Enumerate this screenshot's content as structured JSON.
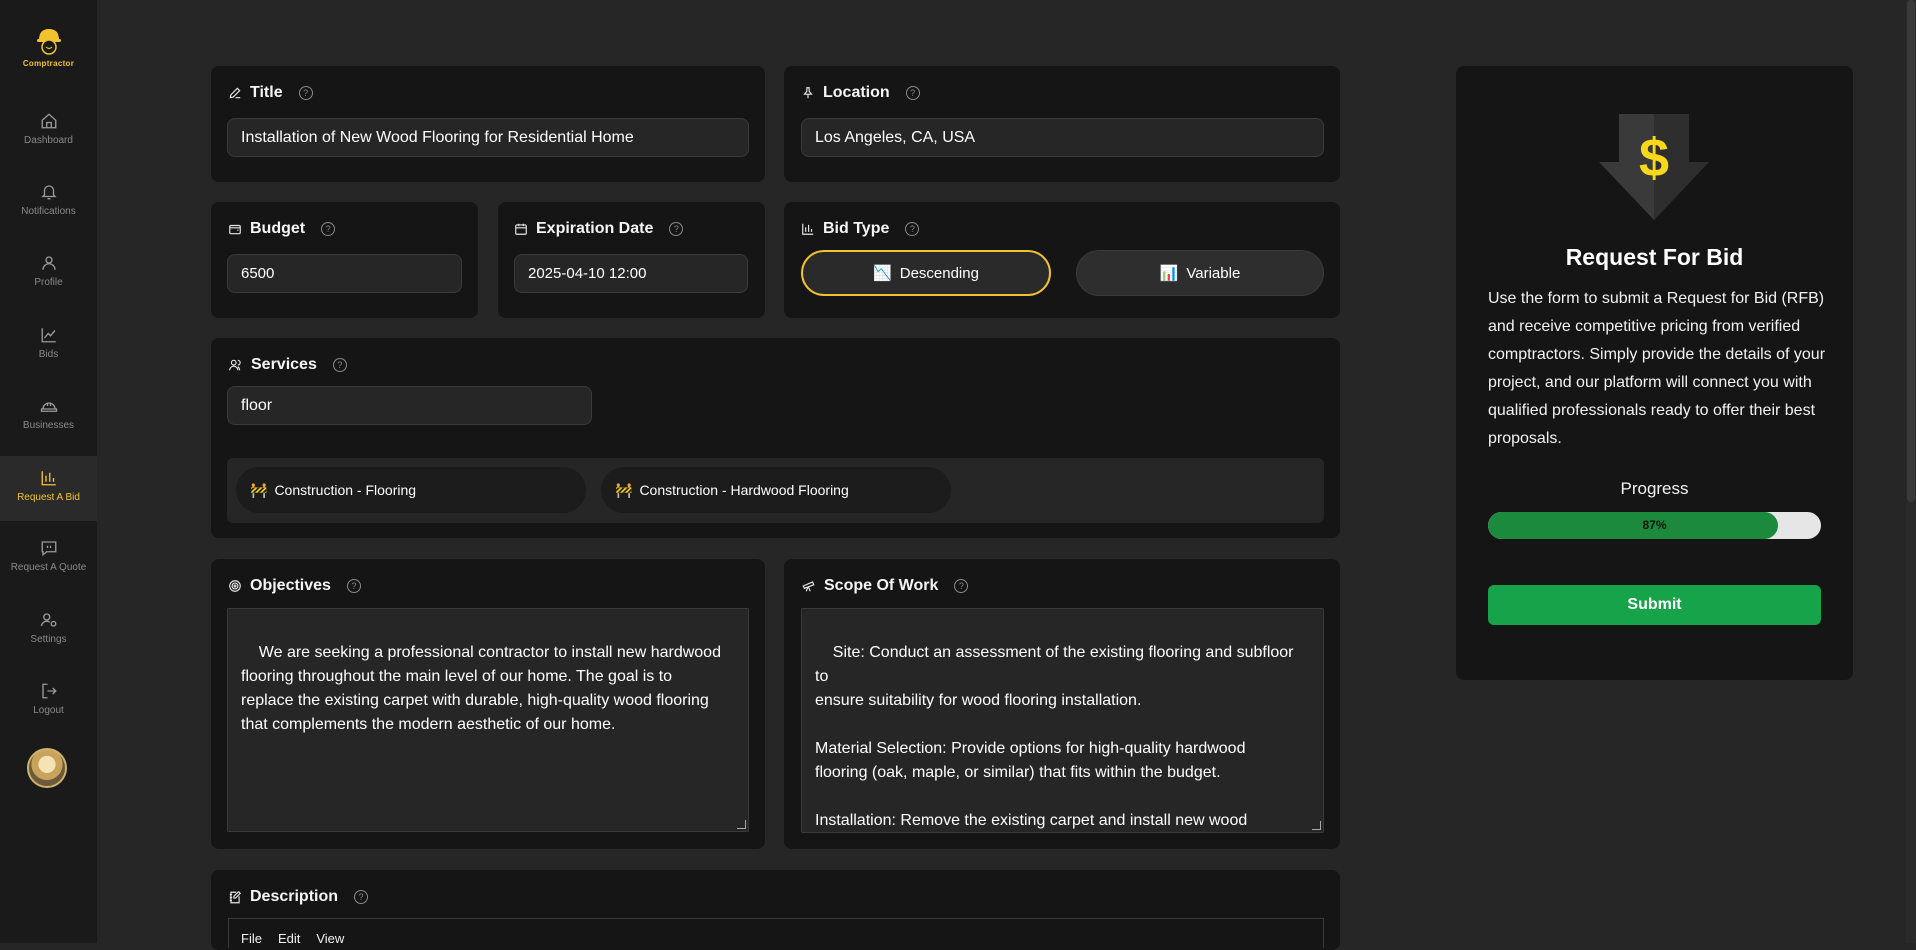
{
  "brand": {
    "name": "Comptractor"
  },
  "sidebar": {
    "items": [
      {
        "label": "Dashboard",
        "icon": "home-icon"
      },
      {
        "label": "Notifications",
        "icon": "bell-icon"
      },
      {
        "label": "Profile",
        "icon": "user-icon"
      },
      {
        "label": "Bids",
        "icon": "line-chart-icon"
      },
      {
        "label": "Businesses",
        "icon": "hardhat-icon"
      },
      {
        "label": "Request A Bid",
        "icon": "bar-chart-icon",
        "active": true
      },
      {
        "label": "Request A Quote",
        "icon": "message-icon"
      },
      {
        "label": "Settings",
        "icon": "user-cog-icon"
      },
      {
        "label": "Logout",
        "icon": "logout-icon"
      }
    ]
  },
  "form": {
    "title": {
      "label": "Title",
      "value": "Installation of New Wood Flooring for Residential Home"
    },
    "location": {
      "label": "Location",
      "value": "Los Angeles, CA, USA"
    },
    "budget": {
      "label": "Budget",
      "value": "6500"
    },
    "expiration": {
      "label": "Expiration Date",
      "value": "2025-04-10 12:00"
    },
    "bid_type": {
      "label": "Bid Type",
      "options": [
        {
          "label": "Descending",
          "emoji": "📉",
          "selected": true
        },
        {
          "label": "Variable",
          "emoji": "📊",
          "selected": false
        }
      ]
    },
    "services": {
      "label": "Services",
      "search_value": "floor",
      "chips": [
        {
          "emoji": "🚧",
          "label": "Construction - Flooring"
        },
        {
          "emoji": "🚧",
          "label": "Construction - Hardwood Flooring"
        }
      ]
    },
    "objectives": {
      "label": "Objectives",
      "value": "We are seeking a professional contractor to install new hardwood\nflooring throughout the main level of our home. The goal is to\nreplace the existing carpet with durable, high-quality wood flooring\nthat complements the modern aesthetic of our home."
    },
    "scope": {
      "label": "Scope Of Work",
      "value": "Site: Conduct an assessment of the existing flooring and subfloor to\nensure suitability for wood flooring installation.\n\nMaterial Selection: Provide options for high-quality hardwood\nflooring (oak, maple, or similar) that fits within the budget.\n\nInstallation: Remove the existing carpet and install new wood\nflooring throughout the living room, dining room, and hallway."
    },
    "description": {
      "label": "Description",
      "menu": [
        "File",
        "Edit",
        "View"
      ]
    }
  },
  "side_panel": {
    "title": "Request For Bid",
    "text": "Use the form to submit a Request for Bid (RFB) and receive competitive pricing from verified comptractors. Simply provide the details of your project, and our platform will connect you with qualified professionals ready to offer their best proposals.",
    "progress_label": "Progress",
    "progress_value": 87,
    "progress_text": "87%",
    "submit_label": "Submit"
  },
  "colors": {
    "accent": "#f2c22e",
    "success": "#16a34a",
    "card": "#151515",
    "background": "#262626"
  }
}
